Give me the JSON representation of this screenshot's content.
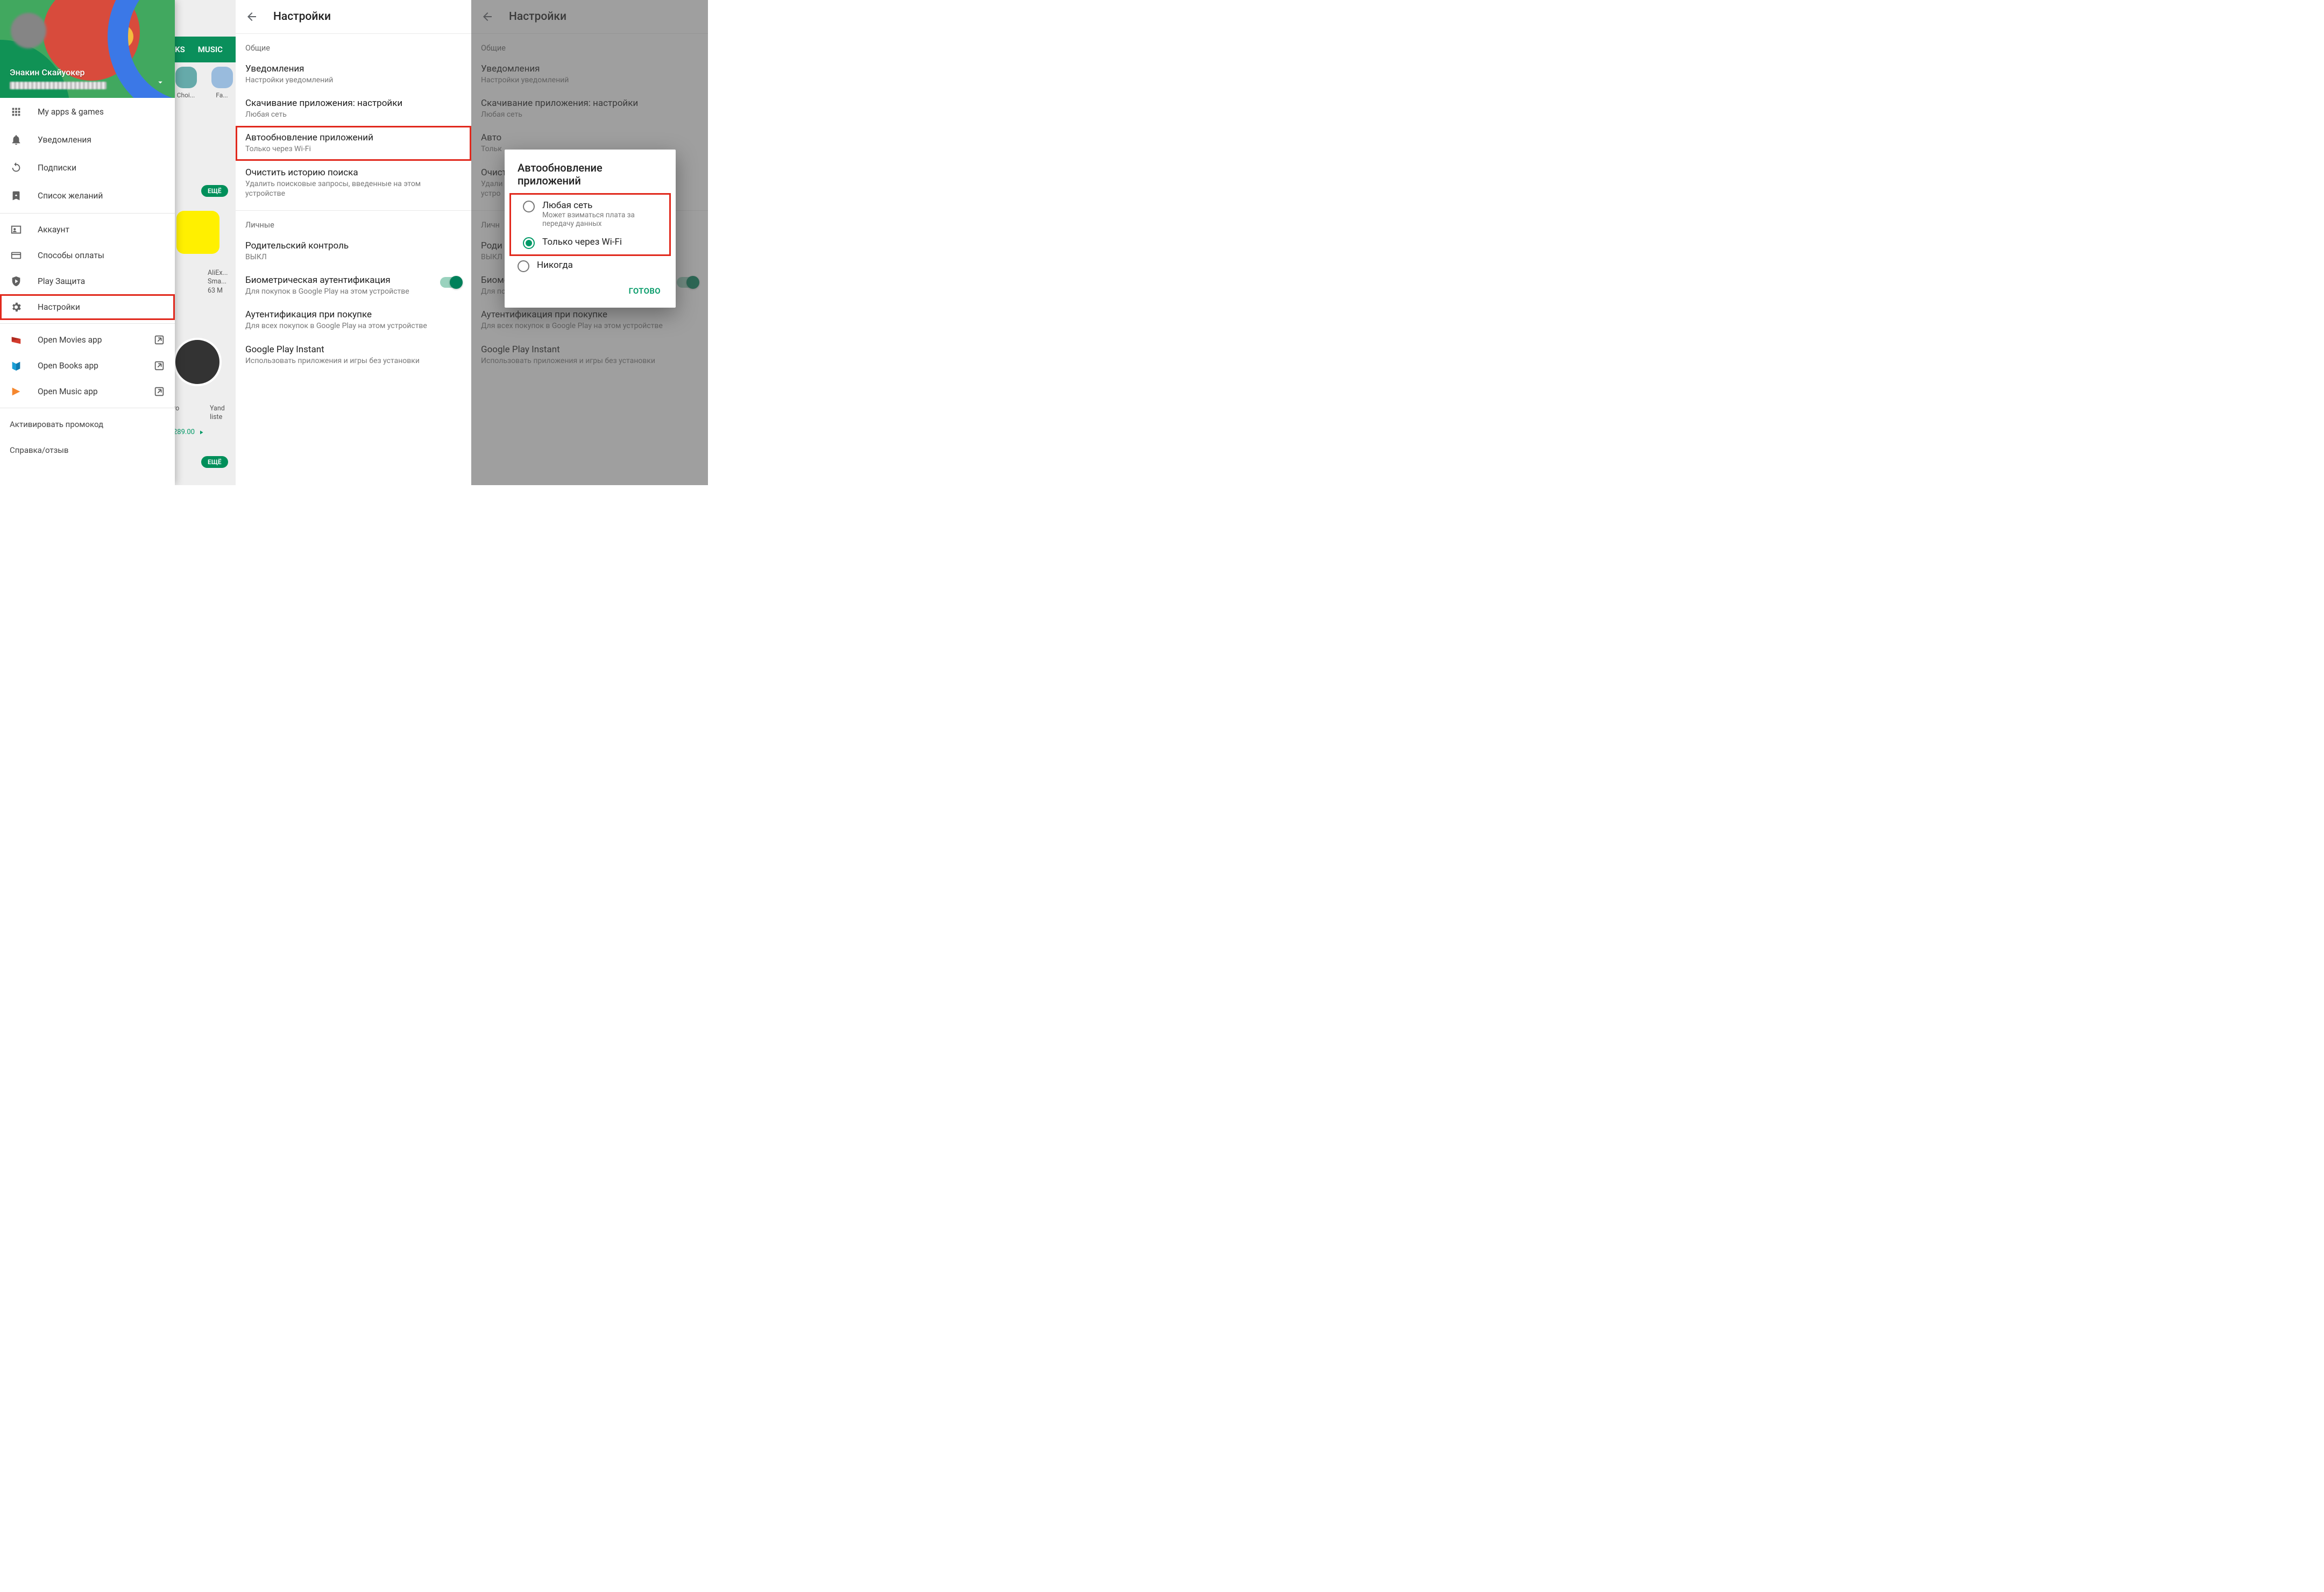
{
  "store": {
    "tabs": {
      "books": "KS",
      "music": "MUSIC"
    },
    "row1": {
      "a": "Choi...",
      "b": "Fa..."
    },
    "more": "ЕЩЁ",
    "row2": {
      "a": "AliEx...",
      "b": "Sma...",
      "c": "63 M"
    },
    "row3": {
      "a": "ro",
      "b": "Yand",
      "c": "liste",
      "d": "289.00"
    }
  },
  "drawer": {
    "user_name": "Энакин Скайуокер",
    "items": {
      "apps": "My apps & games",
      "notif": "Уведомления",
      "subs": "Подписки",
      "wishlist": "Список желаний",
      "account": "Аккаунт",
      "payment": "Способы оплаты",
      "protect": "Play Защита",
      "settings": "Настройки",
      "movies": "Open Movies app",
      "books": "Open Books app",
      "music": "Open Music app",
      "promo": "Активировать промокод",
      "help": "Справка/отзыв"
    }
  },
  "settings": {
    "title": "Настройки",
    "sec_general": "Общие",
    "notif": {
      "t": "Уведомления",
      "s": "Настройки уведомлений"
    },
    "download": {
      "t": "Скачивание приложения: настройки",
      "s": "Любая сеть"
    },
    "auto": {
      "t": "Автообновление приложений",
      "s": "Только через Wi-Fi"
    },
    "clear": {
      "t": "Очистить историю поиска",
      "s": "Удалить поисковые запросы, введенные на этом устройстве"
    },
    "sec_personal": "Личные",
    "parental": {
      "t": "Родительский контроль",
      "s": "ВЫКЛ"
    },
    "biometric": {
      "t": "Биометрическая аутентификация",
      "s": "Для покупок в Google Play на этом устройстве"
    },
    "authpur": {
      "t": "Аутентификация при покупке",
      "s": "Для всех покупок в Google Play на этом устройстве"
    },
    "instant": {
      "t": "Google Play Instant",
      "s": "Использовать приложения и игры без установки"
    }
  },
  "settings3": {
    "auto": {
      "t": "Авто",
      "s": "Тольк"
    },
    "clear": {
      "t": "Очист",
      "s": "Удали\nустро"
    },
    "personal": "Личн",
    "parental": {
      "t": "Роди",
      "s": "ВЫКЛ"
    }
  },
  "dialog": {
    "title": "Автообновление приложений",
    "opt_any": {
      "label": "Любая сеть",
      "sub": "Может взиматься плата за передачу данных"
    },
    "opt_wifi": {
      "label": "Только через Wi-Fi"
    },
    "opt_never": {
      "label": "Никогда"
    },
    "done": "ГОТОВО"
  }
}
